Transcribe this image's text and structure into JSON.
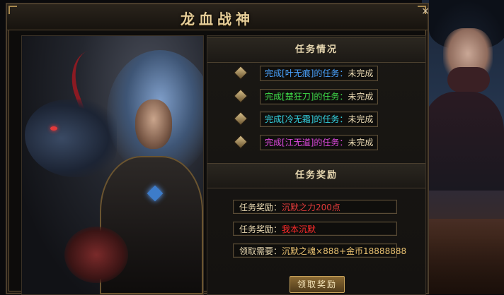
{
  "window": {
    "title": "龙血战神",
    "close_glyph": "×"
  },
  "tasks_section": {
    "heading": "任务情况",
    "tasks": [
      {
        "prefix": "完成",
        "target": "[叶无痕]",
        "suffix": "的任务：",
        "status": "未完成",
        "color": "#4aa3ff"
      },
      {
        "prefix": "完成",
        "target": "[楚狂刀]",
        "suffix": "的任务：",
        "status": "未完成",
        "color": "#3fdc4a"
      },
      {
        "prefix": "完成",
        "target": "[冷无霜]",
        "suffix": "的任务：",
        "status": "未完成",
        "color": "#35d8e6"
      },
      {
        "prefix": "完成",
        "target": "[江无道]",
        "suffix": "的任务：",
        "status": "未完成",
        "color": "#e04ae0"
      }
    ]
  },
  "rewards_section": {
    "heading": "任务奖励",
    "rows": [
      {
        "label": "任务奖励：",
        "value": "沉默之力200点",
        "color": "#e03a3a"
      },
      {
        "label": "任务奖励：",
        "value": "我本沉默",
        "color": "#ff2a2a"
      },
      {
        "label": "领取需要：",
        "value": "沉默之魂×888+金币18888888",
        "color": "#e8c070"
      }
    ],
    "claim_button": "领取奖励"
  }
}
